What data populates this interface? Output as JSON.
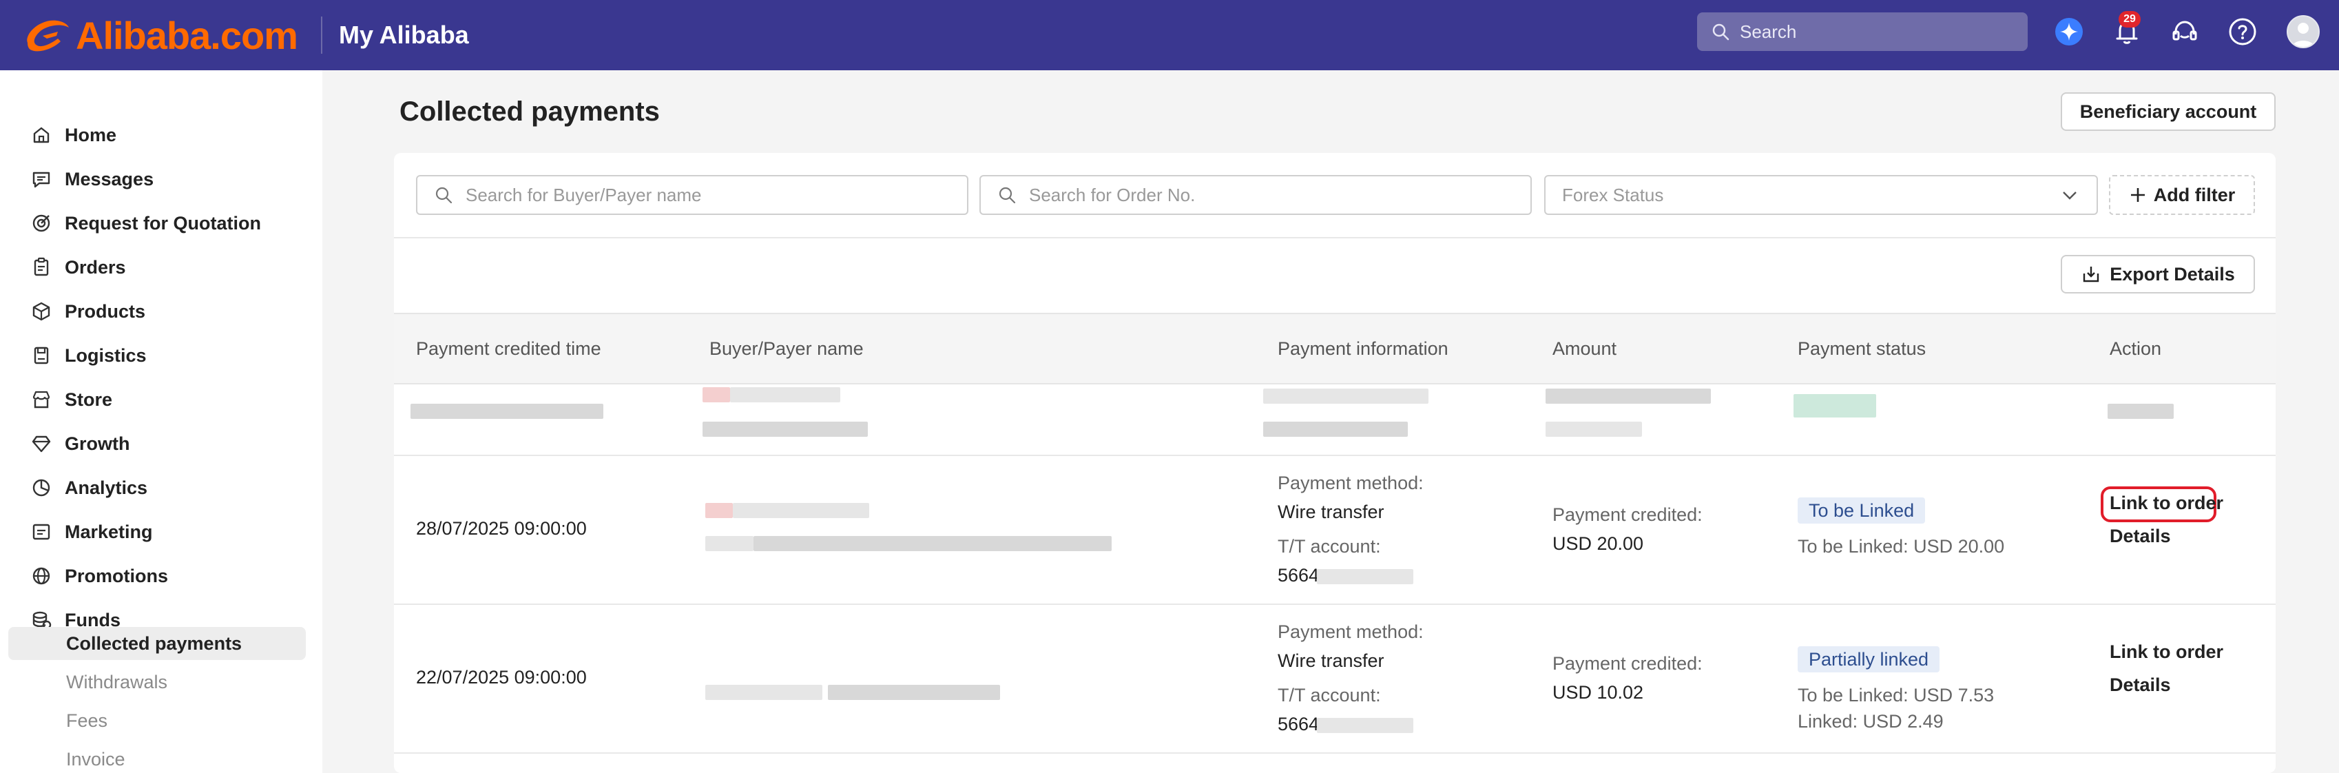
{
  "header": {
    "logo_text": "Alibaba.com",
    "section_title": "My Alibaba",
    "search_placeholder": "Search",
    "notification_count": "29",
    "brand_color": "#3a3790",
    "logo_color": "#ff6a00"
  },
  "sidebar": {
    "items": [
      {
        "label": "Home",
        "icon": "home-icon"
      },
      {
        "label": "Messages",
        "icon": "message-icon"
      },
      {
        "label": "Request for Quotation",
        "icon": "target-icon"
      },
      {
        "label": "Orders",
        "icon": "clipboard-icon"
      },
      {
        "label": "Products",
        "icon": "box-icon"
      },
      {
        "label": "Logistics",
        "icon": "truck-icon"
      },
      {
        "label": "Store",
        "icon": "store-icon"
      },
      {
        "label": "Growth",
        "icon": "diamond-icon"
      },
      {
        "label": "Analytics",
        "icon": "chart-icon"
      },
      {
        "label": "Marketing",
        "icon": "megaphone-icon"
      },
      {
        "label": "Promotions",
        "icon": "globe-icon"
      },
      {
        "label": "Funds",
        "icon": "coins-icon"
      }
    ],
    "funds_sub_items": [
      {
        "label": "Collected payments",
        "active": true
      },
      {
        "label": "Withdrawals",
        "active": false
      },
      {
        "label": "Fees",
        "active": false
      },
      {
        "label": "Invoice",
        "active": false
      }
    ]
  },
  "main": {
    "title": "Collected payments",
    "beneficiary_button": "Beneficiary account",
    "filters": {
      "buyer_placeholder": "Search for Buyer/Payer name",
      "order_placeholder": "Search for Order No.",
      "forex_placeholder": "Forex Status",
      "add_filter_label": "Add filter"
    },
    "export_button": "Export Details",
    "columns": [
      "Payment credited time",
      "Buyer/Payer name",
      "Payment information",
      "Amount",
      "Payment status",
      "Action"
    ],
    "rows": [
      {
        "time": "28/07/2025 09:00:00",
        "method_label": "Payment method:",
        "method_value": "Wire transfer",
        "account_label": "T/T account:",
        "account_value": "5664",
        "amount_label": "Payment credited:",
        "amount_value": "USD 20.00",
        "status": "To be Linked",
        "status_lines": [
          "To be Linked: USD 20.00"
        ],
        "action_link": "Link to order",
        "action_details": "Details"
      },
      {
        "time": "22/07/2025 09:00:00",
        "method_label": "Payment method:",
        "method_value": "Wire transfer",
        "account_label": "T/T account:",
        "account_value": "5664",
        "amount_label": "Payment credited:",
        "amount_value": "USD 10.02",
        "status": "Partially linked",
        "status_lines": [
          "To be Linked: USD 7.53",
          "Linked: USD 2.49"
        ],
        "action_link": "Link to order",
        "action_details": "Details"
      }
    ]
  }
}
